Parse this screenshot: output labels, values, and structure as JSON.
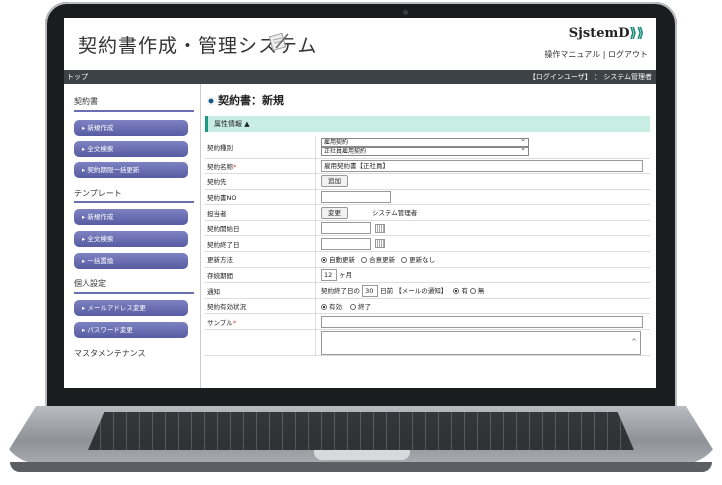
{
  "app": {
    "title": "契約書作成・管理システム",
    "logo_main": "Sjstem",
    "logo_accent": "D",
    "logo_mark": "⟫⟫"
  },
  "header": {
    "manual_link": "操作マニュアル",
    "separator": "|",
    "logout_link": "ログアウト"
  },
  "nav": {
    "breadcrumb": "トップ",
    "user_info": "【ログインユーザ】 ： システム管理者"
  },
  "sidebar": {
    "sections": [
      {
        "title": "契約書",
        "items": [
          "新規作成",
          "全文検索",
          "契約期限一括更新"
        ]
      },
      {
        "title": "テンプレート",
        "items": [
          "新規作成",
          "全文検索",
          "一括置換"
        ]
      },
      {
        "title": "個人設定",
        "items": [
          "メールアドレス変更",
          "パスワード変更"
        ]
      },
      {
        "title": "マスタメンテナンス",
        "items": []
      }
    ],
    "item_prefix": "▸"
  },
  "main": {
    "page_title": "契約書：新規",
    "section_title": "属性情報 ▲",
    "fields": {
      "contract_type_label": "契約種別",
      "contract_type_value1": "雇用契約",
      "contract_type_value2": "正社員雇用契約",
      "contract_name_label": "契約名称",
      "contract_name_value": "雇用契約書【正社員】",
      "partner_label": "契約先",
      "partner_button": "追加",
      "contract_no_label": "契約書NO",
      "owner_label": "担当者",
      "owner_button": "変更",
      "owner_value": "システム管理者",
      "start_date_label": "契約開始日",
      "end_date_label": "契約終了日",
      "renewal_label": "更新方法",
      "renewal_options": [
        "自動更新",
        "合意更新",
        "更新なし"
      ],
      "period_label": "存続期間",
      "period_value": "12",
      "period_unit": "ヶ月",
      "notice_label": "通知",
      "notice_prefix": "契約終了日の",
      "notice_days": "30",
      "notice_suffix": "日前 【メールの通知】",
      "notice_options": [
        "有",
        "無"
      ],
      "validity_label": "契約有効状況",
      "validity_options": [
        "有効",
        "終了"
      ],
      "sample_label": "サンプル"
    },
    "required_mark": "*"
  }
}
